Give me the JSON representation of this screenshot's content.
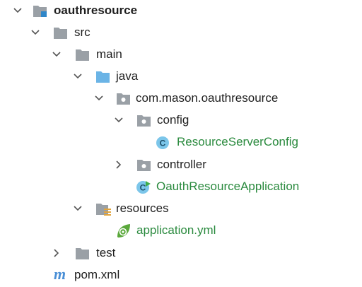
{
  "tree": {
    "root": {
      "label": "oauthresource",
      "icon": "module-folder-icon",
      "expanded": true
    },
    "src": {
      "label": "src",
      "icon": "folder-icon",
      "expanded": true
    },
    "main": {
      "label": "main",
      "icon": "folder-icon",
      "expanded": true
    },
    "java": {
      "label": "java",
      "icon": "source-root-folder-icon",
      "expanded": true
    },
    "package": {
      "label": "com.mason.oauthresource",
      "icon": "package-icon",
      "expanded": true
    },
    "config": {
      "label": "config",
      "icon": "package-icon",
      "expanded": true
    },
    "resource_server_config": {
      "label": "ResourceServerConfig",
      "icon": "java-class-icon"
    },
    "controller": {
      "label": "controller",
      "icon": "package-icon",
      "expanded": false
    },
    "oauth_resource_application": {
      "label": "OauthResourceApplication",
      "icon": "spring-boot-class-icon"
    },
    "resources": {
      "label": "resources",
      "icon": "resources-folder-icon",
      "expanded": true
    },
    "application_yml": {
      "label": "application.yml",
      "icon": "spring-config-icon"
    },
    "test": {
      "label": "test",
      "icon": "folder-icon",
      "expanded": false
    },
    "pom": {
      "label": "pom.xml",
      "icon": "maven-icon"
    }
  },
  "colors": {
    "folder_gray": "#9aa0a6",
    "source_blue": "#6bb4e6",
    "class_circle": "#7cc6ea",
    "spring_green": "#5aa83b",
    "label_green": "#2a8a3e",
    "maven_blue": "#4a8fd6",
    "chevron": "#555555"
  }
}
